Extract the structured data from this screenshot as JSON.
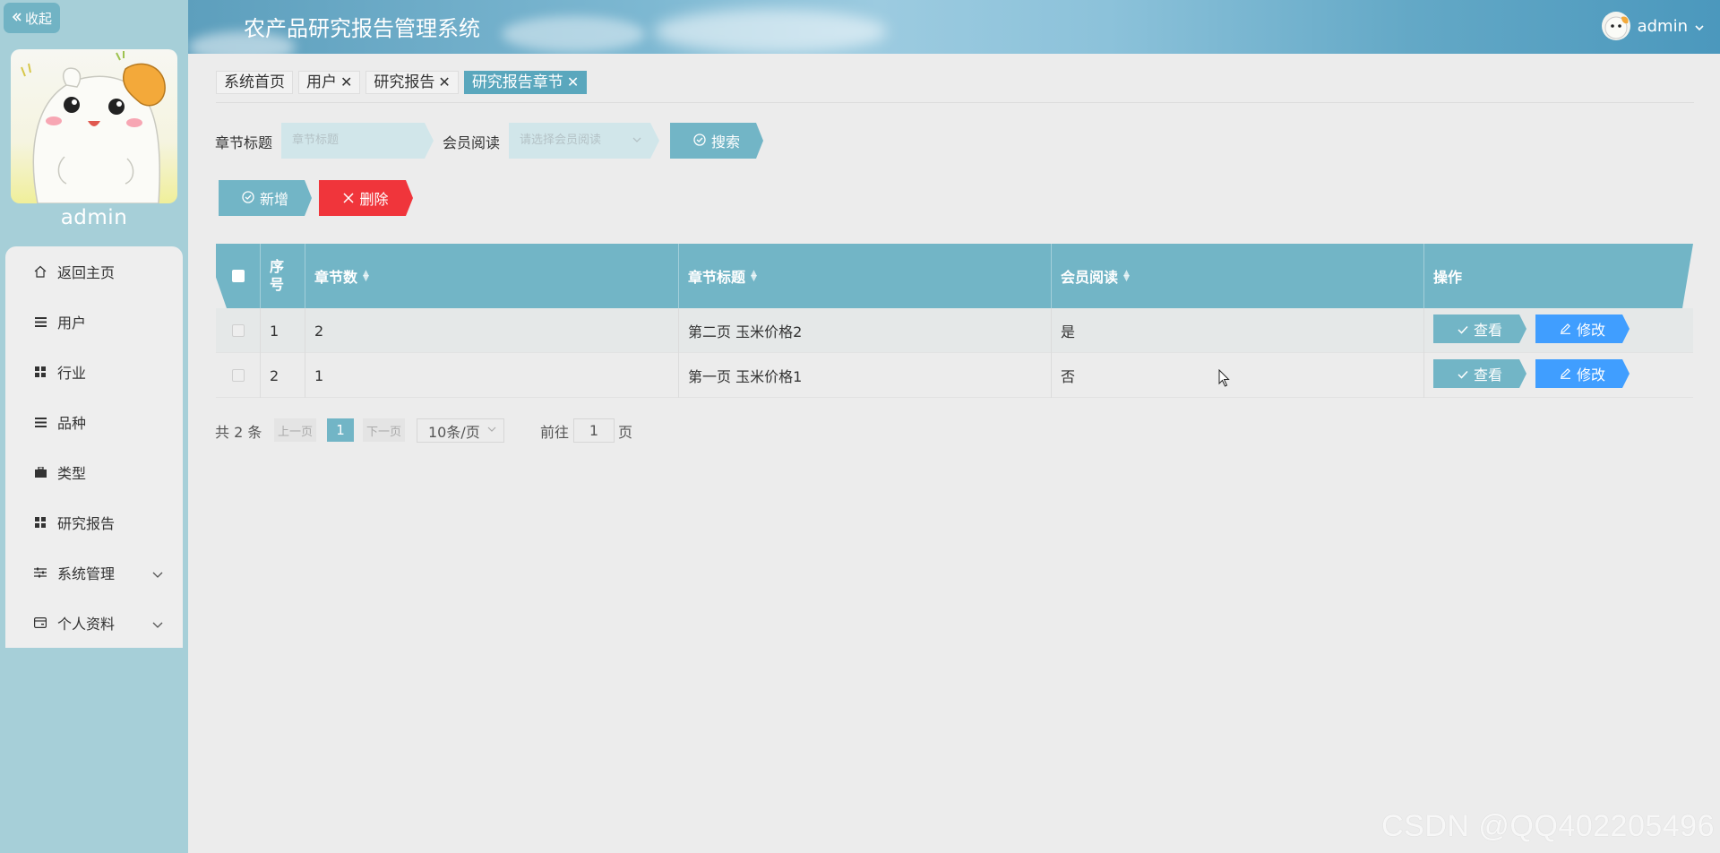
{
  "sidebar": {
    "collapse_label": "收起",
    "username": "admin",
    "items": [
      {
        "label": "返回主页",
        "icon": "home-icon"
      },
      {
        "label": "用户",
        "icon": "list-icon"
      },
      {
        "label": "行业",
        "icon": "grid-icon"
      },
      {
        "label": "品种",
        "icon": "list-icon"
      },
      {
        "label": "类型",
        "icon": "briefcase-icon"
      },
      {
        "label": "研究报告",
        "icon": "grid-icon"
      },
      {
        "label": "系统管理",
        "icon": "sliders-icon",
        "expandable": true
      },
      {
        "label": "个人资料",
        "icon": "card-icon",
        "expandable": true
      }
    ]
  },
  "header": {
    "title": "农产品研究报告管理系统",
    "username": "admin"
  },
  "tabs": [
    {
      "label": "系统首页",
      "closable": false,
      "active": false
    },
    {
      "label": "用户",
      "closable": true,
      "active": false
    },
    {
      "label": "研究报告",
      "closable": true,
      "active": false
    },
    {
      "label": "研究报告章节",
      "closable": true,
      "active": true
    }
  ],
  "search": {
    "title_label": "章节标题",
    "title_placeholder": "章节标题",
    "member_label": "会员阅读",
    "member_placeholder": "请选择会员阅读",
    "search_button": "搜索"
  },
  "actions": {
    "add_button": "新增",
    "delete_button": "删除"
  },
  "table": {
    "columns": {
      "index": "序号",
      "chapter_count": "章节数",
      "chapter_title": "章节标题",
      "member_read": "会员阅读",
      "operations": "操作"
    },
    "rows": [
      {
        "index": "1",
        "chapter_count": "2",
        "chapter_title": "第二页 玉米价格2",
        "member_read": "是"
      },
      {
        "index": "2",
        "chapter_count": "1",
        "chapter_title": "第一页 玉米价格1",
        "member_read": "否"
      }
    ],
    "view_button": "查看",
    "edit_button": "修改"
  },
  "pagination": {
    "total_text": "共 2 条",
    "prev": "上一页",
    "current_page": "1",
    "next": "下一页",
    "page_size": "10条/页",
    "goto_prefix": "前往",
    "goto_value": "1",
    "goto_suffix": "页"
  },
  "watermark": "CSDN @QQ402205496",
  "colors": {
    "primary": "#72b5c6",
    "danger": "#f0353b",
    "edit": "#409eff",
    "sidebar_bg": "#a6cfd8"
  }
}
